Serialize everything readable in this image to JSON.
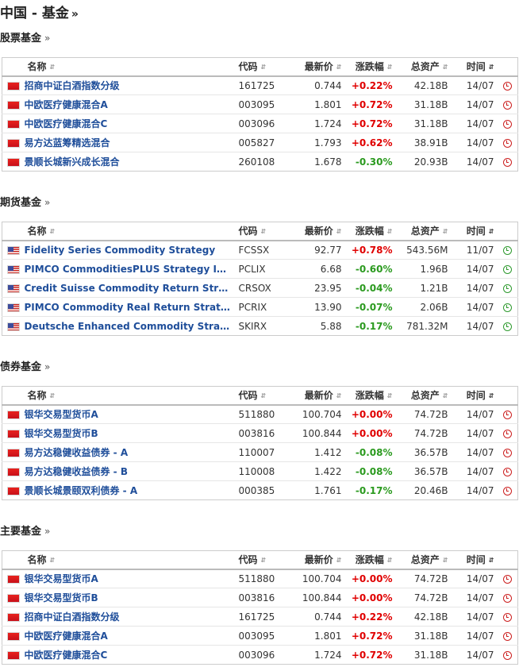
{
  "page_title": "中国 - 基金",
  "raquo": "»",
  "columns": {
    "name": "名称",
    "code": "代码",
    "last": "最新价",
    "change": "涨跌幅",
    "assets": "总资产",
    "time": "时间"
  },
  "icons": {
    "sort": "sort-arrows-icon",
    "flag_cn": "china-flag-icon",
    "flag_us": "us-flag-icon",
    "clock": "clock-icon"
  },
  "colors": {
    "positive": "#e00000",
    "negative": "#2b9a1f",
    "link": "#1f4e9a",
    "market_closed": "#cc1f1f",
    "market_open": "#2e9a2e"
  },
  "sections": [
    {
      "title": "股票基金",
      "rows": [
        {
          "flag": "cn",
          "name": "招商中证白酒指数分级",
          "code": "161725",
          "last": "0.744",
          "change": "+0.22%",
          "assets": "42.18B",
          "time": "14/07",
          "status": "closed"
        },
        {
          "flag": "cn",
          "name": "中欧医疗健康混合A",
          "code": "003095",
          "last": "1.801",
          "change": "+0.72%",
          "assets": "31.18B",
          "time": "14/07",
          "status": "closed"
        },
        {
          "flag": "cn",
          "name": "中欧医疗健康混合C",
          "code": "003096",
          "last": "1.724",
          "change": "+0.72%",
          "assets": "31.18B",
          "time": "14/07",
          "status": "closed"
        },
        {
          "flag": "cn",
          "name": "易方达蓝筹精选混合",
          "code": "005827",
          "last": "1.793",
          "change": "+0.62%",
          "assets": "38.91B",
          "time": "14/07",
          "status": "closed"
        },
        {
          "flag": "cn",
          "name": "景顺长城新兴成长混合",
          "code": "260108",
          "last": "1.678",
          "change": "-0.30%",
          "assets": "20.93B",
          "time": "14/07",
          "status": "closed"
        }
      ]
    },
    {
      "title": "期货基金",
      "rows": [
        {
          "flag": "us",
          "name": "Fidelity Series Commodity Strategy",
          "code": "FCSSX",
          "last": "92.77",
          "change": "+0.78%",
          "assets": "543.56M",
          "time": "11/07",
          "status": "open"
        },
        {
          "flag": "us",
          "name": "PIMCO CommoditiesPLUS Strategy Instl",
          "code": "PCLIX",
          "last": "6.68",
          "change": "-0.60%",
          "assets": "1.96B",
          "time": "14/07",
          "status": "open"
        },
        {
          "flag": "us",
          "name": "Credit Suisse Commodity Return Strat I",
          "code": "CRSOX",
          "last": "23.95",
          "change": "-0.04%",
          "assets": "1.21B",
          "time": "14/07",
          "status": "open"
        },
        {
          "flag": "us",
          "name": "PIMCO Commodity Real Return Strate…",
          "code": "PCRIX",
          "last": "13.90",
          "change": "-0.07%",
          "assets": "2.06B",
          "time": "14/07",
          "status": "open"
        },
        {
          "flag": "us",
          "name": "Deutsche Enhanced Commodity Strat I…",
          "code": "SKIRX",
          "last": "5.88",
          "change": "-0.17%",
          "assets": "781.32M",
          "time": "14/07",
          "status": "open"
        }
      ]
    },
    {
      "title": "债券基金",
      "rows": [
        {
          "flag": "cn",
          "name": "银华交易型货币A",
          "code": "511880",
          "last": "100.704",
          "change": "+0.00%",
          "assets": "74.72B",
          "time": "14/07",
          "status": "closed"
        },
        {
          "flag": "cn",
          "name": "银华交易型货币B",
          "code": "003816",
          "last": "100.844",
          "change": "+0.00%",
          "assets": "74.72B",
          "time": "14/07",
          "status": "closed"
        },
        {
          "flag": "cn",
          "name": "易方达稳健收益债券 - A",
          "code": "110007",
          "last": "1.412",
          "change": "-0.08%",
          "assets": "36.57B",
          "time": "14/07",
          "status": "closed"
        },
        {
          "flag": "cn",
          "name": "易方达稳健收益债券 - B",
          "code": "110008",
          "last": "1.422",
          "change": "-0.08%",
          "assets": "36.57B",
          "time": "14/07",
          "status": "closed"
        },
        {
          "flag": "cn",
          "name": "景顺长城景颐双利债券 - A",
          "code": "000385",
          "last": "1.761",
          "change": "-0.17%",
          "assets": "20.46B",
          "time": "14/07",
          "status": "closed"
        }
      ]
    },
    {
      "title": "主要基金",
      "rows": [
        {
          "flag": "cn",
          "name": "银华交易型货币A",
          "code": "511880",
          "last": "100.704",
          "change": "+0.00%",
          "assets": "74.72B",
          "time": "14/07",
          "status": "closed"
        },
        {
          "flag": "cn",
          "name": "银华交易型货币B",
          "code": "003816",
          "last": "100.844",
          "change": "+0.00%",
          "assets": "74.72B",
          "time": "14/07",
          "status": "closed"
        },
        {
          "flag": "cn",
          "name": "招商中证白酒指数分级",
          "code": "161725",
          "last": "0.744",
          "change": "+0.22%",
          "assets": "42.18B",
          "time": "14/07",
          "status": "closed"
        },
        {
          "flag": "cn",
          "name": "中欧医疗健康混合A",
          "code": "003095",
          "last": "1.801",
          "change": "+0.72%",
          "assets": "31.18B",
          "time": "14/07",
          "status": "closed"
        },
        {
          "flag": "cn",
          "name": "中欧医疗健康混合C",
          "code": "003096",
          "last": "1.724",
          "change": "+0.72%",
          "assets": "31.18B",
          "time": "14/07",
          "status": "closed"
        }
      ]
    }
  ]
}
